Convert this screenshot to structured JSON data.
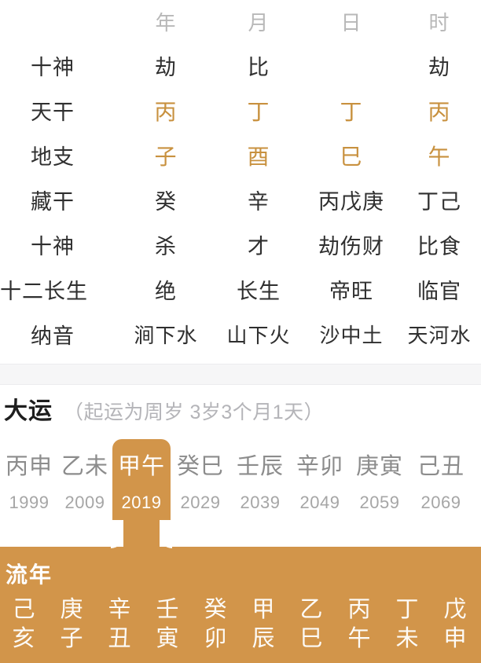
{
  "pillar_table": {
    "column_headers": [
      "",
      "年",
      "月",
      "日",
      "时"
    ],
    "rows": [
      {
        "label": "十神",
        "values": [
          "劫",
          "比",
          "",
          "劫"
        ],
        "style": "plain"
      },
      {
        "label": "天干",
        "values": [
          "丙",
          "丁",
          "丁",
          "丙"
        ],
        "style": "gold"
      },
      {
        "label": "地支",
        "values": [
          "子",
          "酉",
          "巳",
          "午"
        ],
        "style": "gold"
      },
      {
        "label": "藏干",
        "values": [
          "癸",
          "辛",
          "丙戊庚",
          "丁己"
        ],
        "style": "plain"
      },
      {
        "label": "十神",
        "values": [
          "杀",
          "才",
          "劫伤财",
          "比食"
        ],
        "style": "plain"
      },
      {
        "label": "十二长生",
        "values": [
          "绝",
          "长生",
          "帝旺",
          "临官"
        ],
        "style": "plain"
      },
      {
        "label": "纳音",
        "values": [
          "涧下水",
          "山下火",
          "沙中土",
          "天河水"
        ],
        "style": "nayin"
      }
    ]
  },
  "dayun": {
    "title": "大运",
    "subtitle": "（起运为周岁 3岁3个月1天）",
    "items": [
      {
        "ganzhi": "丙申",
        "year": "1999",
        "selected": false
      },
      {
        "ganzhi": "乙未",
        "year": "2009",
        "selected": false
      },
      {
        "ganzhi": "甲午",
        "year": "2019",
        "selected": true
      },
      {
        "ganzhi": "癸巳",
        "year": "2029",
        "selected": false
      },
      {
        "ganzhi": "壬辰",
        "year": "2039",
        "selected": false
      },
      {
        "ganzhi": "辛卯",
        "year": "2049",
        "selected": false
      },
      {
        "ganzhi": "庚寅",
        "year": "2059",
        "selected": false
      },
      {
        "ganzhi": "己丑",
        "year": "2069",
        "selected": false
      }
    ]
  },
  "liunian": {
    "title": "流年",
    "items": [
      {
        "stem": "己",
        "branch": "亥"
      },
      {
        "stem": "庚",
        "branch": "子"
      },
      {
        "stem": "辛",
        "branch": "丑"
      },
      {
        "stem": "壬",
        "branch": "寅"
      },
      {
        "stem": "癸",
        "branch": "卯"
      },
      {
        "stem": "甲",
        "branch": "辰"
      },
      {
        "stem": "乙",
        "branch": "巳"
      },
      {
        "stem": "丙",
        "branch": "午"
      },
      {
        "stem": "丁",
        "branch": "未"
      },
      {
        "stem": "戊",
        "branch": "申"
      }
    ]
  },
  "colors": {
    "accent_gold": "#d2954a",
    "stem_gold": "#c8913f",
    "text_primary": "#2f2f2f",
    "text_muted": "#b4b4b8",
    "dayun_gray": "#8c8c8c",
    "background": "#ffffff",
    "divider": "#f6f6f7"
  }
}
